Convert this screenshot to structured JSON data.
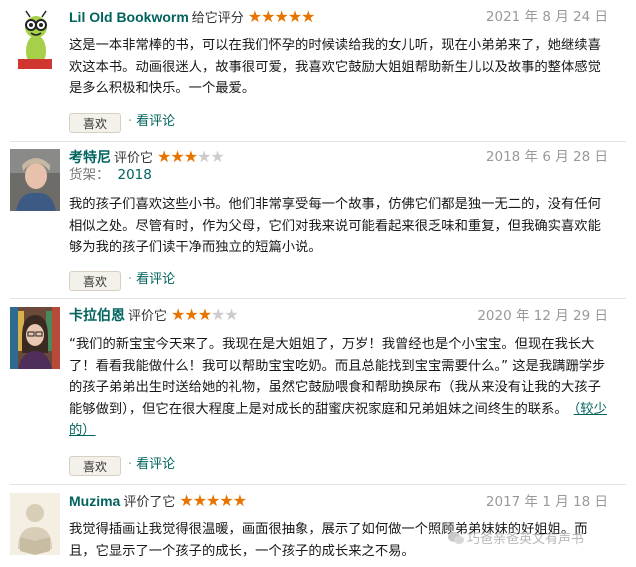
{
  "reviews": [
    {
      "user": "Lil Old Bookworm",
      "verb": "给它评分",
      "rating": 5,
      "date": "2021 年 8 月 24 日",
      "body": "这是一本非常棒的书，可以在我们怀孕的时候读给我的女儿听，现在小弟弟来了，她继续喜欢这本书。动画很迷人，故事很可爱，我喜欢它鼓励大姐姐帮助新生儿以及故事的整体感觉是多么积极和快乐。一个最爱。",
      "like_label": "喜欢",
      "comment_label": "看评论"
    },
    {
      "user": "考特尼",
      "verb": "评价它",
      "rating": 3,
      "date": "2018 年 6 月 28 日",
      "shelf_label": "货架：",
      "shelf_value": "2018",
      "body": "我的孩子们喜欢这些小书。他们非常享受每一个故事，仿佛它们都是独一无二的，没有任何相似之处。尽管有时，作为父母，它们对我来说可能看起来很乏味和重复，但我确实喜欢能够为我的孩子们读干净而独立的短篇小说。",
      "like_label": "喜欢",
      "comment_label": "看评论"
    },
    {
      "user": "卡拉伯恩",
      "verb": "评价它",
      "rating": 3,
      "date": "2020 年 12 月 29 日",
      "body": "“我们的新宝宝今天来了。我现在是大姐姐了，万岁！我曾经也是个小宝宝。但现在我长大了！看看我能做什么！我可以帮助宝宝吃奶。而且总能找到宝宝需要什么。” 这是我蹒跚学步的孩子弟弟出生时送给她的礼物，虽然它鼓励喂食和帮助换尿布（我从来没有让我的大孩子能够做到），但它在很大程度上是对成长的甜蜜庆祝家庭和兄弟姐妹之间终生的联系。",
      "more_label": "（较少的）",
      "like_label": "喜欢",
      "comment_label": "看评论"
    },
    {
      "user": "Muzima",
      "verb": "评价了它",
      "rating": 5,
      "date": "2017 年 1 月 18 日",
      "body": "我觉得插画让我觉得很温暖，画面很抽象，展示了如何做一个照顾弟弟妹妹的好姐姐。而且，它显示了一个孩子的成长，一个孩子的成长来之不易。"
    }
  ],
  "watermark": "巧爸亲爸英文有声书",
  "colors": {
    "accent": "#00635d",
    "star": "#e87400",
    "star_empty": "#cccccc"
  }
}
